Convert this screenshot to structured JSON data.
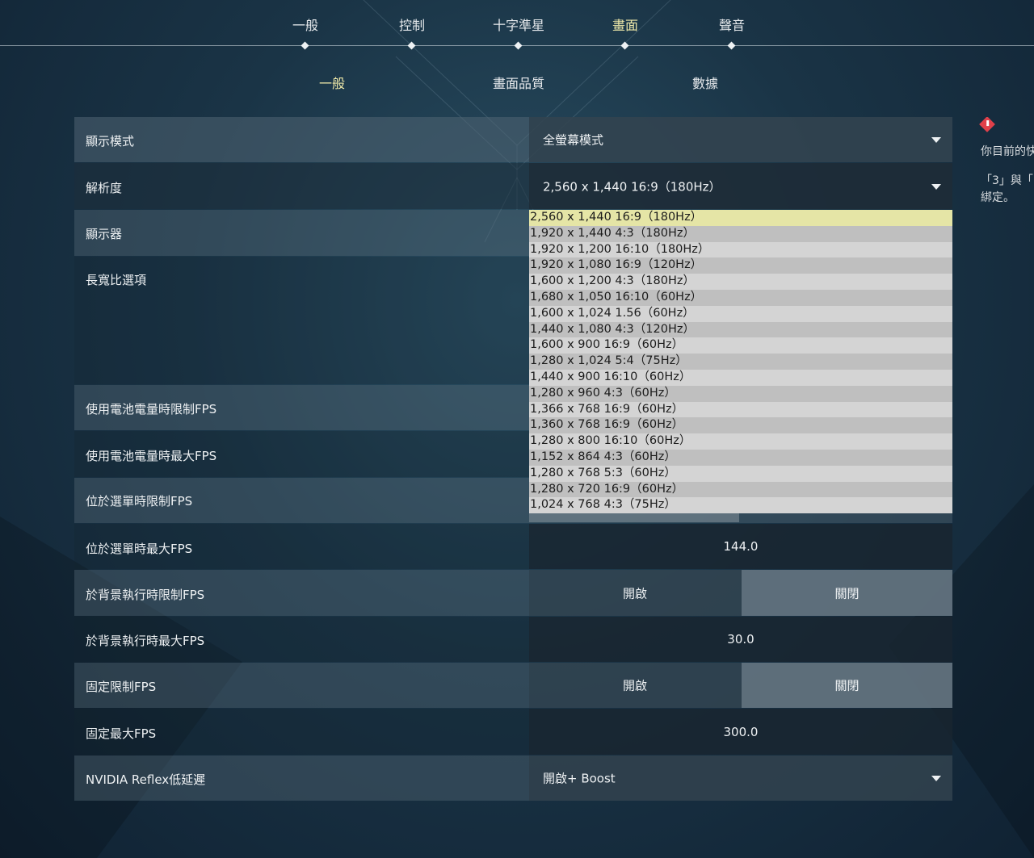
{
  "colors": {
    "accent_text": "#efe9a9",
    "dropdown_selected_bg": "#e5e5a6",
    "warning_icon": "#e0404a"
  },
  "top_tabs": [
    {
      "label": "一般",
      "active": false
    },
    {
      "label": "控制",
      "active": false
    },
    {
      "label": "十字準星",
      "active": false
    },
    {
      "label": "畫面",
      "active": true
    },
    {
      "label": "聲音",
      "active": false
    }
  ],
  "sub_tabs": [
    {
      "label": "一般",
      "active": true
    },
    {
      "label": "畫面品質",
      "active": false
    },
    {
      "label": "數據",
      "active": false
    }
  ],
  "settings": {
    "display_mode": {
      "label": "顯示模式",
      "value": "全螢幕模式"
    },
    "resolution": {
      "label": "解析度",
      "value": "2,560 x 1,440 16:9（180Hz）"
    },
    "monitor": {
      "label": "顯示器"
    },
    "aspect_ratio": {
      "label": "長寬比選項"
    },
    "battery_limit_fps": {
      "label": "使用電池電量時限制FPS"
    },
    "battery_max_fps": {
      "label": "使用電池電量時最大FPS"
    },
    "menu_limit_fps": {
      "label": "位於選單時限制FPS"
    },
    "menu_max_fps": {
      "label": "位於選單時最大FPS",
      "value": "144.0"
    },
    "bg_limit_fps": {
      "label": "於背景執行時限制FPS",
      "on_label": "開啟",
      "off_label": "關閉",
      "selected": "off"
    },
    "bg_max_fps": {
      "label": "於背景執行時最大FPS",
      "value": "30.0"
    },
    "fixed_limit_fps": {
      "label": "固定限制FPS",
      "on_label": "開啟",
      "off_label": "關閉",
      "selected": "off"
    },
    "fixed_max_fps": {
      "label": "固定最大FPS",
      "value": "300.0"
    },
    "reflex": {
      "label": "NVIDIA Reflex低延遲",
      "value": "開啟+ Boost"
    }
  },
  "resolution_options": [
    "2,560 x 1,440 16:9（180Hz）",
    "1,920 x 1,440 4:3（180Hz）",
    "1,920 x 1,200 16:10（180Hz）",
    "1,920 x 1,080 16:9（120Hz）",
    "1,600 x 1,200 4:3（180Hz）",
    "1,680 x 1,050 16:10（60Hz）",
    "1,600 x 1,024 1.56（60Hz）",
    "1,440 x 1,080 4:3（120Hz）",
    "1,600 x 900 16:9（60Hz）",
    "1,280 x 1,024 5:4（75Hz）",
    "1,440 x 900 16:10（60Hz）",
    "1,280 x 960 4:3（60Hz）",
    "1,366 x 768 16:9（60Hz）",
    "1,360 x 768 16:9（60Hz）",
    "1,280 x 800 16:10（60Hz）",
    "1,152 x 864 4:3（60Hz）",
    "1,280 x 768 5:3（60Hz）",
    "1,280 x 720 16:9（60Hz）",
    "1,024 x 768 4:3（75Hz）"
  ],
  "resolution_selected_index": 0,
  "warning": {
    "icon": "warning-diamond-icon",
    "line1": "你目前的快",
    "line2": "「3」與「",
    "line3": "綁定。"
  }
}
